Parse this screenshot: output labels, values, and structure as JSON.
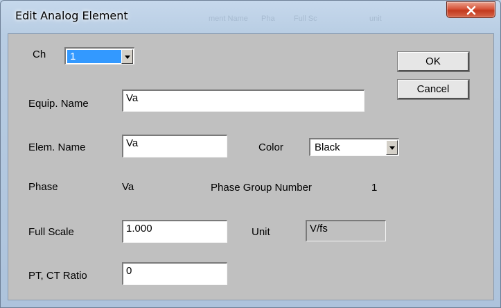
{
  "window": {
    "title": "Edit Analog Element"
  },
  "background_hint": {
    "items": [
      "ment Name",
      "Pha",
      "Full Sc",
      "unit"
    ]
  },
  "channel": {
    "label": "Ch",
    "value": "1"
  },
  "buttons": {
    "ok": "OK",
    "cancel": "Cancel"
  },
  "equip_name": {
    "label": "Equip. Name",
    "value": "Va"
  },
  "elem_name": {
    "label": "Elem. Name",
    "value": "Va"
  },
  "color": {
    "label": "Color",
    "value": "Black"
  },
  "phase": {
    "label": "Phase",
    "value": "Va",
    "group_label": "Phase Group Number",
    "group_value": "1"
  },
  "full_scale": {
    "label": "Full Scale",
    "value": "1.000"
  },
  "unit": {
    "label": "Unit",
    "value": "V/fs"
  },
  "ratio": {
    "label": "PT, CT Ratio",
    "value": "0"
  },
  "colors": {
    "title_bar": "#bcd0e6",
    "dialog_face": "#c0c0c0",
    "selection": "#3399ff",
    "close_button": "#c9452b"
  },
  "icons": {
    "close": "close-icon",
    "dropdown": "chevron-down-icon"
  }
}
